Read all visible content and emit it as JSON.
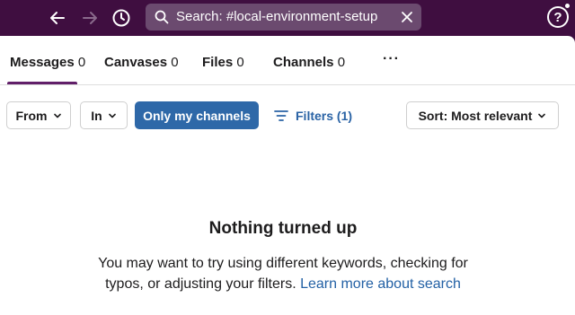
{
  "topbar": {
    "search": {
      "text": "Search: #local-environment-setup"
    },
    "help_label": "?"
  },
  "tabs": [
    {
      "label": "Messages",
      "count": "0",
      "active": true
    },
    {
      "label": "Canvases",
      "count": "0",
      "active": false
    },
    {
      "label": "Files",
      "count": "0",
      "active": false
    },
    {
      "label": "Channels",
      "count": "0",
      "active": false
    }
  ],
  "tabs_more": "···",
  "filters": {
    "from_label": "From",
    "in_label": "In",
    "only_my_channels_label": "Only my channels",
    "filters_label": "Filters (1)",
    "sort_label": "Sort: Most relevant"
  },
  "empty_state": {
    "title": "Nothing turned up",
    "body": "You may want to try using different keywords, checking for typos, or adjusting your filters.",
    "link": "Learn more about search"
  },
  "colors": {
    "topbar": "#3f0e40",
    "search_bg": "#6b4a6f",
    "primary": "#2e68a8",
    "link": "#2361a5",
    "active_tab": "#611f69"
  },
  "icons": [
    "back-arrow-icon",
    "forward-arrow-icon",
    "history-clock-icon",
    "search-icon",
    "clear-x-icon",
    "help-icon",
    "chevron-down-icon",
    "filter-lines-icon",
    "more-dots-icon"
  ]
}
